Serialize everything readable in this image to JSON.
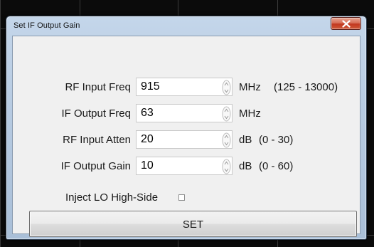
{
  "window": {
    "title": "Set IF Output Gain",
    "close_icon": "close-x-icon"
  },
  "fields": [
    {
      "label": "RF Input Freq",
      "value": "915",
      "unit": "MHz",
      "range": "(125 - 13000)"
    },
    {
      "label": "IF Output Freq",
      "value": "63",
      "unit": "MHz",
      "range": ""
    },
    {
      "label": "RF Input Atten",
      "value": "20",
      "unit": "dB",
      "range": "(0 - 30)"
    },
    {
      "label": "IF Output Gain",
      "value": "10",
      "unit": "dB",
      "range": "(0 - 60)"
    }
  ],
  "inject": {
    "label": "Inject LO High-Side",
    "checked": false
  },
  "set_button": {
    "label": "SET"
  },
  "colors": {
    "background": "#0b0b0b",
    "frame": "#b7cbe2",
    "client": "#f0f0f0",
    "close_button": "#c2371f"
  }
}
